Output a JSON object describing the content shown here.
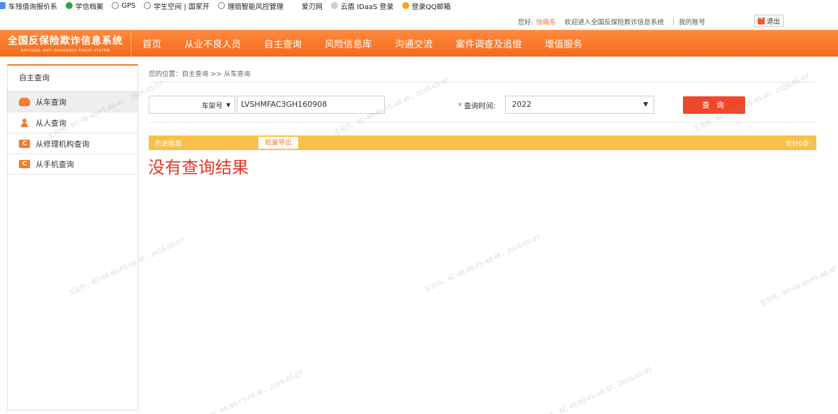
{
  "bookmarks": [
    {
      "label": "车残值询报价系",
      "icon": "bookmark-icon",
      "color": "#4a90e2"
    },
    {
      "label": "学信档案",
      "icon": "leaf-icon",
      "color": "#2ea64a"
    },
    {
      "label": "GPS",
      "icon": "globe-icon",
      "color": "#888888"
    },
    {
      "label": "学生空间 | 国家开",
      "icon": "globe-icon",
      "color": "#888888"
    },
    {
      "label": "理赔智能风控管理",
      "icon": "globe-icon",
      "color": "#888888"
    },
    {
      "label": "爱刃网",
      "icon": "blank-icon",
      "color": "#ffffff"
    },
    {
      "label": "云盾 IDaaS 登录",
      "icon": "cloud-icon",
      "color": "#cccccc"
    },
    {
      "label": "登录QQ邮箱",
      "icon": "qq-icon",
      "color": "#f5a623"
    }
  ],
  "topbar": {
    "greeting": "您好:",
    "username": "徐晓东",
    "welcome": "欢迎进入全国反保险欺诈信息系统",
    "separator": "|",
    "account_link": "我的账号",
    "logout_label": "退出"
  },
  "brand": {
    "title": "全国反保险欺诈信息系统",
    "subtitle": "NATIONAL ANTI INSURANCE FRAUD SYSTEM"
  },
  "nav": {
    "items": [
      "首页",
      "从业不良人员",
      "自主查询",
      "风险信息库",
      "沟通交流",
      "案件调查及追偿",
      "增值服务"
    ]
  },
  "sidebar": {
    "heading": "自主查询",
    "items": [
      {
        "label": "从车查询",
        "icon": "car-icon",
        "active": true
      },
      {
        "label": "从人查询",
        "icon": "person-icon",
        "active": false
      },
      {
        "label": "从修理机构查询",
        "icon": "repair-shop-icon",
        "active": false
      },
      {
        "label": "从手机查询",
        "icon": "phone-icon",
        "active": false
      }
    ]
  },
  "main": {
    "breadcrumb": "您的位置：自主查询 >> 从车查询",
    "search": {
      "field_type": "车架号",
      "vin_value": "LVSHMFAC3GH160908",
      "required_mark": "*",
      "time_label": "查询时间:",
      "year_value": "2022",
      "query_button": "查 询"
    },
    "results": {
      "tab_label": "历史赔案",
      "export_button": "批量导出",
      "count_text": "共计0条",
      "empty_message": "没有查询结果"
    }
  },
  "watermark": {
    "text": "王云丹、6C-48-90-F5-48-4F、2026-05-07"
  },
  "colors": {
    "brand_orange": "#f47a2a",
    "query_button": "#f0462a",
    "result_bar": "#f9c04a",
    "empty_text": "#e8352a"
  }
}
